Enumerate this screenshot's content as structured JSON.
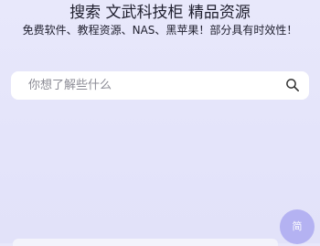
{
  "header": {
    "title": "搜索 文武科技柜 精品资源",
    "subtitle": "免费软件、教程资源、NAS、黑苹果！部分具有时效性！"
  },
  "search": {
    "placeholder": "你想了解些什么",
    "icon": "search-icon"
  },
  "floating_button": {
    "label": "简",
    "color": "#b4b2f2"
  },
  "colors": {
    "background": "#e6e6fa",
    "search_bg": "#ffffff",
    "placeholder": "#8c8c96"
  }
}
